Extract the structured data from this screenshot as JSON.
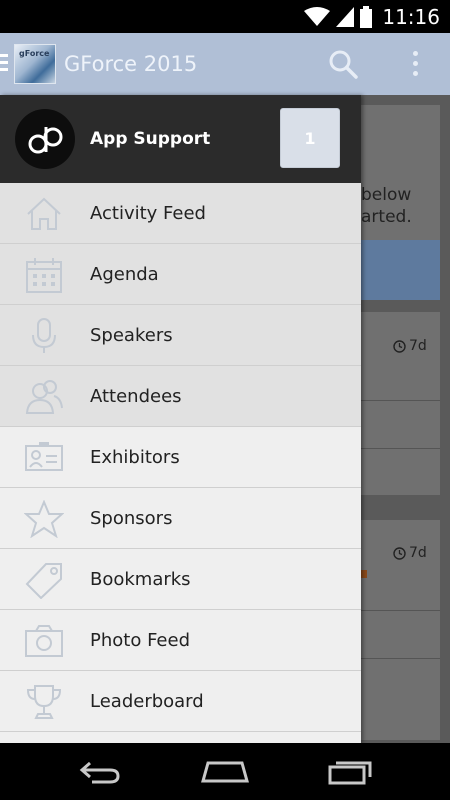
{
  "status_bar": {
    "time": "11:16"
  },
  "app_bar": {
    "title": "GForce 2015",
    "logo_text": "gForce"
  },
  "main": {
    "welcome_line1": "below",
    "welcome_line2": "arted.",
    "post_times": [
      "7d",
      "7d"
    ]
  },
  "drawer": {
    "brand_name": "App Support",
    "badge_count": "1",
    "items": [
      {
        "label": "Activity Feed",
        "icon": "home-icon"
      },
      {
        "label": "Agenda",
        "icon": "calendar-icon"
      },
      {
        "label": "Speakers",
        "icon": "microphone-icon"
      },
      {
        "label": "Attendees",
        "icon": "people-icon"
      },
      {
        "label": "Exhibitors",
        "icon": "id-card-icon"
      },
      {
        "label": "Sponsors",
        "icon": "star-icon"
      },
      {
        "label": "Bookmarks",
        "icon": "tag-icon"
      },
      {
        "label": "Photo Feed",
        "icon": "camera-icon"
      },
      {
        "label": "Leaderboard",
        "icon": "trophy-icon"
      }
    ]
  },
  "colors": {
    "app_bar": "#b0bfd6",
    "drawer_header": "#2b2b2b",
    "drawer_bg": "#efefef",
    "selected_item": "#e1e1e1",
    "icon_stroke": "#c3cad3"
  }
}
